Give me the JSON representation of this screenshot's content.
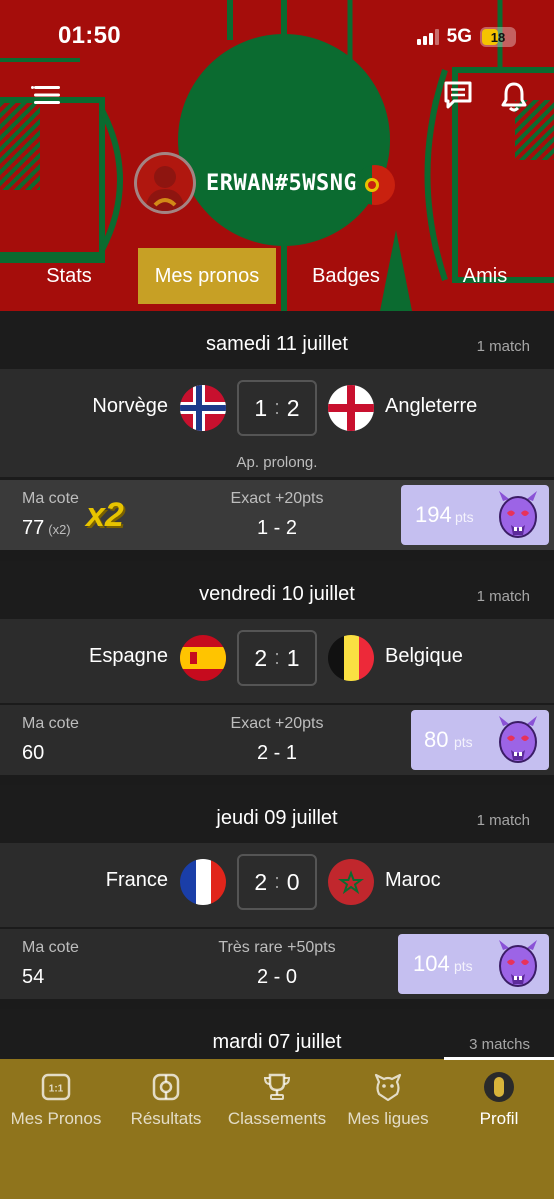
{
  "status_bar": {
    "time": "01:50",
    "network": "5G",
    "battery": "18"
  },
  "profile": {
    "username": "ERWAN#5WSNG"
  },
  "tabs": [
    {
      "label": "Stats",
      "active": false
    },
    {
      "label": "Mes pronos",
      "active": true
    },
    {
      "label": "Badges",
      "active": false
    },
    {
      "label": "Amis",
      "active": false
    }
  ],
  "days": [
    {
      "date": "samedi 11 juillet",
      "count": "1 match",
      "match": {
        "home": "Norvège",
        "away": "Angleterre",
        "home_score": "1",
        "away_score": "2",
        "note": "Ap. prolong."
      },
      "prono": {
        "cote_label": "Ma cote",
        "cote": "77",
        "multiplier": "(x2)",
        "bonus_badge": "x2",
        "result_label": "Exact +20pts",
        "prediction": "1 - 2",
        "points": "194",
        "points_unit": "pts"
      }
    },
    {
      "date": "vendredi 10 juillet",
      "count": "1 match",
      "match": {
        "home": "Espagne",
        "away": "Belgique",
        "home_score": "2",
        "away_score": "1"
      },
      "prono": {
        "cote_label": "Ma cote",
        "cote": "60",
        "result_label": "Exact +20pts",
        "prediction": "2 - 1",
        "points": "80",
        "points_unit": "pts"
      }
    },
    {
      "date": "jeudi 09 juillet",
      "count": "1 match",
      "match": {
        "home": "France",
        "away": "Maroc",
        "home_score": "2",
        "away_score": "0"
      },
      "prono": {
        "cote_label": "Ma cote",
        "cote": "54",
        "result_label": "Très rare +50pts",
        "prediction": "2 - 0",
        "points": "104",
        "points_unit": "pts"
      }
    },
    {
      "date": "mardi 07 juillet",
      "count": "3 matchs"
    }
  ],
  "bottom_nav": [
    {
      "label": "Mes Pronos",
      "icon": "pronos-icon"
    },
    {
      "label": "Résultats",
      "icon": "results-icon"
    },
    {
      "label": "Classements",
      "icon": "trophy-icon"
    },
    {
      "label": "Mes ligues",
      "icon": "league-icon"
    },
    {
      "label": "Profil",
      "icon": "profile-icon",
      "active": true
    }
  ],
  "colors": {
    "header_red": "#a50d0b",
    "header_green": "#0b6b30",
    "active_tab": "#c7a025",
    "nav_bg": "#8f741c",
    "points_card": "#c5bff0"
  }
}
